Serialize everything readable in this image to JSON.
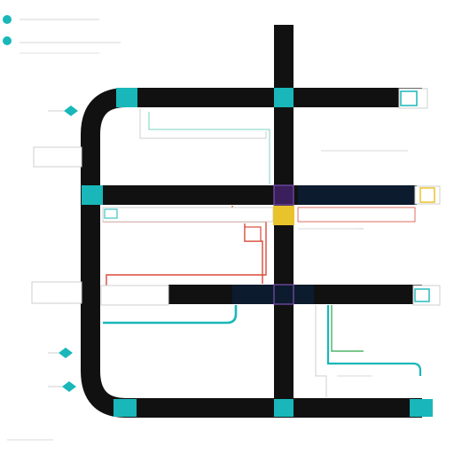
{
  "legend": {
    "title": "",
    "items": [
      {
        "label": "",
        "color": "#19b7b9"
      }
    ]
  },
  "colors": {
    "track": "#111111",
    "teal": "#19b7b9",
    "navy": "#0d1b2e",
    "red": "#d94a3a",
    "green": "#2aa84a",
    "yellow": "#e8c32c",
    "purple": "#5a2e8a"
  },
  "stations": [
    {
      "id": "top-left-stop",
      "label": ""
    },
    {
      "id": "top-center-stop",
      "label": ""
    },
    {
      "id": "top-right-stop",
      "label": ""
    },
    {
      "id": "mid-left-stop",
      "label": ""
    },
    {
      "id": "mid-center-stop",
      "label": ""
    },
    {
      "id": "mid-right-stop",
      "label": ""
    },
    {
      "id": "hub-stop",
      "label": ""
    },
    {
      "id": "lower-center-stop",
      "label": ""
    },
    {
      "id": "lower-right-stop",
      "label": ""
    },
    {
      "id": "bottom-left-stop",
      "label": ""
    },
    {
      "id": "bottom-center-stop",
      "label": ""
    },
    {
      "id": "bottom-right-stop",
      "label": ""
    }
  ],
  "footer": {
    "text": ""
  }
}
